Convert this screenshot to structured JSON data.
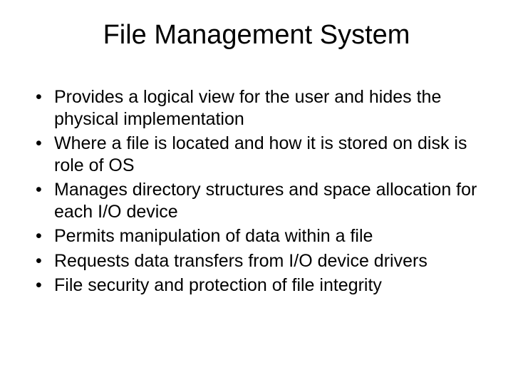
{
  "slide": {
    "title": "File Management System",
    "bullets": [
      "Provides a logical view for the user and hides the physical implementation",
      "Where a file is located and how it is stored on disk is role of OS",
      "Manages directory structures and space allocation for each I/O device",
      "Permits manipulation of data within a file",
      "Requests data transfers from I/O device drivers",
      "File security and protection of file integrity"
    ]
  }
}
